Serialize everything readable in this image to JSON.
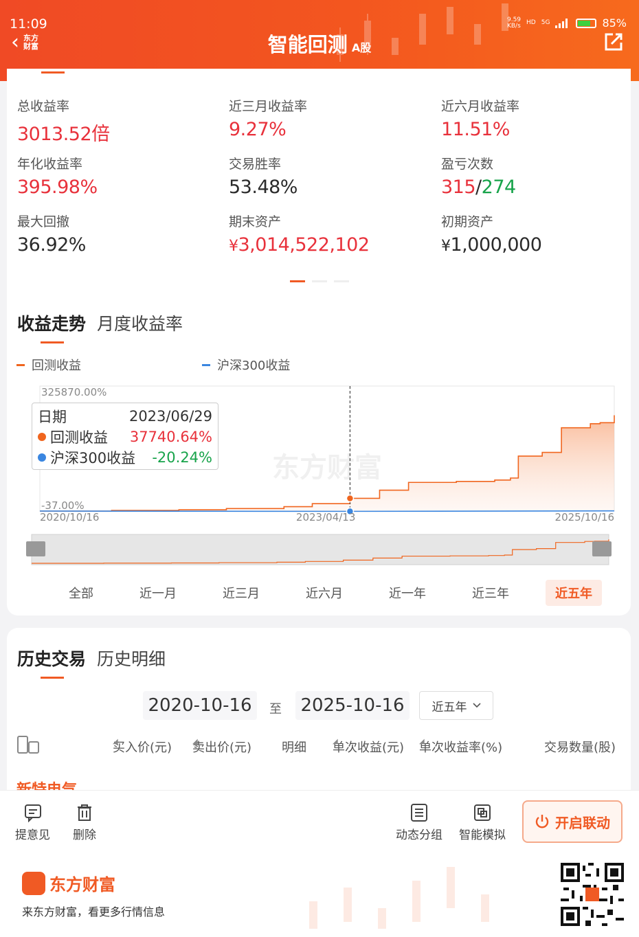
{
  "status_bar": {
    "time": "11:09",
    "speed": "9.59",
    "speed_unit": "KB/s",
    "hd": "HD",
    "net": "5G",
    "battery": "85%"
  },
  "header": {
    "back_logo": "东方财富",
    "title": "智能回测",
    "title_suffix": "A股"
  },
  "stats": [
    {
      "label": "总收益率",
      "value": "3013.52倍",
      "tone": "red"
    },
    {
      "label": "近三月收益率",
      "value": "9.27%",
      "tone": "red"
    },
    {
      "label": "近六月收益率",
      "value": "11.51%",
      "tone": "red"
    },
    {
      "label": "年化收益率",
      "value": "395.98%",
      "tone": "red"
    },
    {
      "label": "交易胜率",
      "value": "53.48%",
      "tone": "dark"
    },
    {
      "label": "盈亏次数",
      "value_win": "315",
      "value_sep": "/",
      "value_loss": "274"
    },
    {
      "label": "最大回撤",
      "value": "36.92%",
      "tone": "dark"
    },
    {
      "label": "期末资产",
      "yen": "¥",
      "value": "3,014,522,102",
      "tone": "red"
    },
    {
      "label": "初期资产",
      "yen": "¥",
      "value": "1,000,000",
      "tone": "dark"
    }
  ],
  "chart_section": {
    "tabs": [
      "收益走势",
      "月度收益率"
    ],
    "legend": [
      "回测收益",
      "沪深300收益"
    ],
    "range_tabs": [
      "全部",
      "近一月",
      "近三月",
      "近六月",
      "近一年",
      "近三年",
      "近五年"
    ],
    "active_range": "近五年"
  },
  "tooltip": {
    "date_label": "日期",
    "date": "2023/06/29",
    "series1_label": "回测收益",
    "series1_value": "37740.64%",
    "series2_label": "沪深300收益",
    "series2_value": "-20.24%"
  },
  "chart_data": {
    "type": "area",
    "y_max_label": "325870.00%",
    "y_min_label": "-37.00%",
    "ylim": [
      -37,
      325870
    ],
    "x_ticks": [
      "2020/10/16",
      "2023/04/13",
      "2025/10/16"
    ],
    "watermark": "东方财富",
    "series": [
      {
        "name": "回测收益",
        "color": "#f0651e",
        "x": [
          "2020/10/16",
          "2021/06/01",
          "2022/01/01",
          "2022/06/01",
          "2022/12/01",
          "2023/03/01",
          "2023/06/29",
          "2023/10/01",
          "2024/01/01",
          "2024/06/01",
          "2024/10/01",
          "2024/11/20",
          "2024/12/15",
          "2025/03/01",
          "2025/05/01",
          "2025/08/01",
          "2025/09/01",
          "2025/10/16"
        ],
        "values": [
          -37,
          2000,
          4000,
          7500,
          13000,
          22000,
          37740,
          62000,
          85000,
          88000,
          92000,
          98000,
          163000,
          174000,
          247000,
          259000,
          262000,
          284000
        ]
      },
      {
        "name": "沪深300收益",
        "color": "#3a86e0",
        "x": [
          "2020/10/16",
          "2023/06/29",
          "2025/10/16"
        ],
        "values": [
          0,
          -20.24,
          15
        ]
      }
    ]
  },
  "history": {
    "tabs": [
      "历史交易",
      "历史明细"
    ],
    "date_from": "2020-10-16",
    "to_label": "至",
    "date_to": "2025-10-16",
    "period": "近五年",
    "columns": [
      "买入价(元)",
      "卖出价(元)",
      "明细",
      "单次收益(元)",
      "单次收益率(%)",
      "交易数量(股)"
    ],
    "first_row_peek": "新特电气"
  },
  "toolbar": {
    "feedback": "提意见",
    "delete": "删除",
    "group": "动态分组",
    "simulate": "智能模拟",
    "link": "开启联动"
  },
  "footer": {
    "brand": "东方财富",
    "slogan": "来东方财富，看更多行情信息"
  },
  "colors": {
    "accent": "#f05a24",
    "red": "#e8313b",
    "green": "#17a34a",
    "benchmark_blue": "#3a86e0"
  }
}
